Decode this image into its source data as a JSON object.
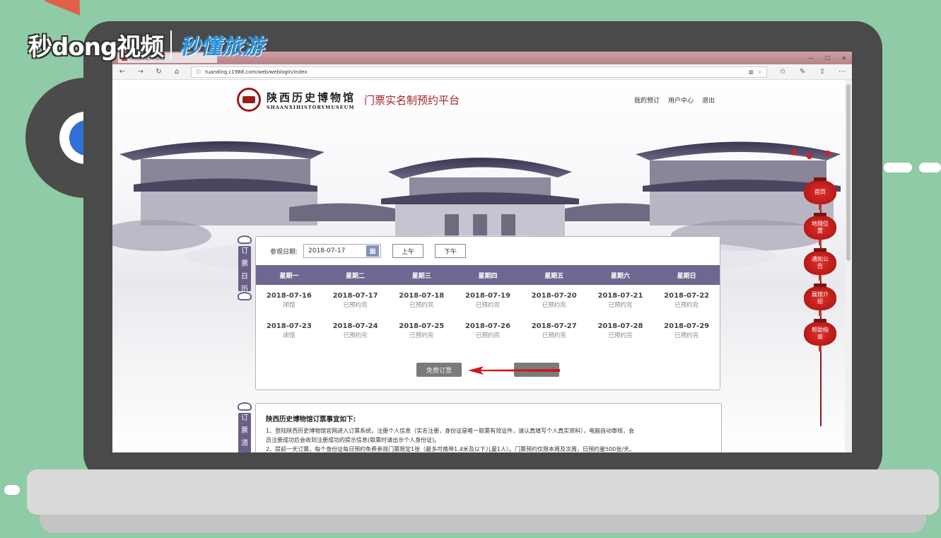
{
  "brand": {
    "main": "秒dong视频",
    "sub": "秒懂旅游"
  },
  "browser": {
    "tab_title": "陕西历史博物馆",
    "url": "tuanding.c1988.com/web/weblogin/index",
    "icons": [
      "back-icon",
      "forward-icon",
      "refresh-icon",
      "home-icon",
      "reading-view-icon",
      "favorite-star-icon",
      "favorites-icon",
      "pen-icon",
      "share-icon",
      "more-icon"
    ]
  },
  "header": {
    "museum_cn": "陕西历史博物馆",
    "museum_en": "SHAANXIHISTORYMUSEUM",
    "platform_title": "门票实名制预约平台",
    "nav": [
      "我的预订",
      "用户中心",
      "退出"
    ]
  },
  "side_labels": {
    "calendar": [
      "订",
      "票",
      "日",
      "历"
    ],
    "notice": [
      "订",
      "票",
      "须",
      "知"
    ]
  },
  "calendar": {
    "date_label": "参观日期:",
    "date_value": "2018-07-17",
    "morning": "上午",
    "afternoon": "下午",
    "weekdays": [
      "星期一",
      "星期二",
      "星期三",
      "星期四",
      "星期五",
      "星期六",
      "星期日"
    ],
    "weeks": [
      [
        {
          "date": "2018-07-16",
          "status": "闭馆"
        },
        {
          "date": "2018-07-17",
          "status": "已预约完"
        },
        {
          "date": "2018-07-18",
          "status": "已预约完"
        },
        {
          "date": "2018-07-19",
          "status": "已预约完"
        },
        {
          "date": "2018-07-20",
          "status": "已预约完"
        },
        {
          "date": "2018-07-21",
          "status": "已预约完"
        },
        {
          "date": "2018-07-22",
          "status": "已预约完"
        }
      ],
      [
        {
          "date": "2018-07-23",
          "status": "闭馆"
        },
        {
          "date": "2018-07-24",
          "status": "已预约完"
        },
        {
          "date": "2018-07-25",
          "status": "已预约完"
        },
        {
          "date": "2018-07-26",
          "status": "已预约完"
        },
        {
          "date": "2018-07-27",
          "status": "已预约完"
        },
        {
          "date": "2018-07-28",
          "status": "已预约完"
        },
        {
          "date": "2018-07-29",
          "status": "已预约完"
        }
      ]
    ],
    "actions": {
      "free_ticket": "免费订票",
      "second": ""
    }
  },
  "notice": {
    "title": "陕西历史博物馆订票事宜如下:",
    "lines": [
      "1、登陆陕西历史博物馆官网进入订票系统，注册个人信息（实名注册，身份证是唯一取票有效证件，请认真填写个人真实资料），电脑自动审核，会",
      "员注册成功后会收到注册成功的提示信息(取票时请出示个人身份证)。",
      "2、提前一天订票，每个身份证每日预约免费参观门票限定1张（最多可携带1.4米及以下儿童1人）。门票预约仅限本周及次周，日预约量500张/天。"
    ]
  },
  "lanterns": [
    "首页",
    "地理位置",
    "通知公告",
    "展馆介绍",
    "帮助指南"
  ],
  "colors": {
    "accent": "#6e6790",
    "brand_red": "#a3242a",
    "lantern": "#c0201c",
    "arrow": "#d0161d",
    "background": "#8ecba6"
  }
}
